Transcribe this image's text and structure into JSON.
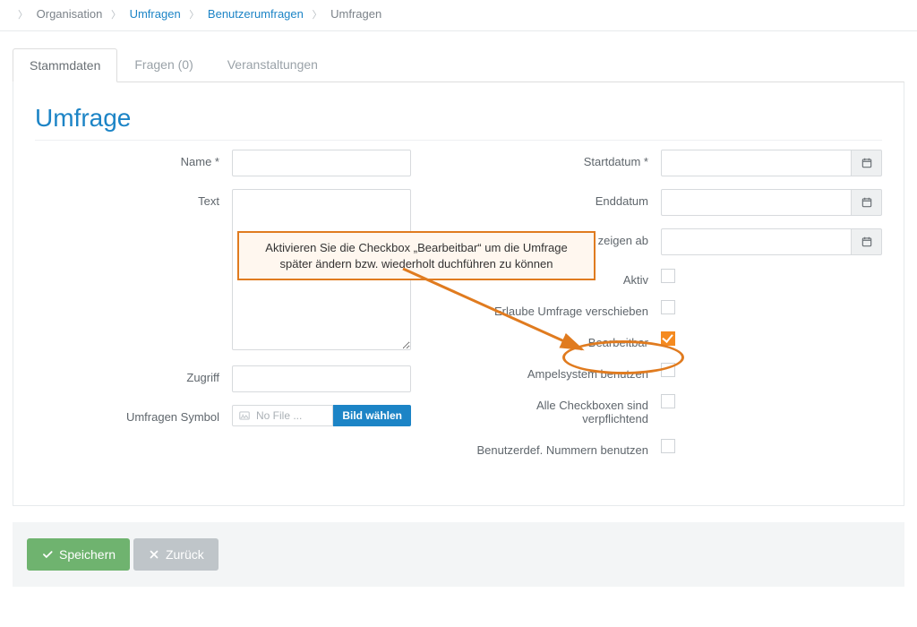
{
  "breadcrumb": {
    "root": "Organisation",
    "a": "Umfragen",
    "b": "Benutzerumfragen",
    "current": "Umfragen"
  },
  "tabs": {
    "t1": "Stammdaten",
    "t2": "Fragen (0)",
    "t3": "Veranstaltungen"
  },
  "title": "Umfrage",
  "left": {
    "name_label": "Name *",
    "text_label": "Text",
    "zugriff_label": "Zugriff",
    "symbol_label": "Umfragen Symbol",
    "nofile": "No File ...",
    "choose": "Bild wählen"
  },
  "right": {
    "start_label": "Startdatum *",
    "end_label": "Enddatum",
    "showfrom_label": "zeigen ab",
    "aktiv_label": "Aktiv",
    "move_label": "Erlaube Umfrage verschieben",
    "edit_label": "Bearbeitbar",
    "ampel_label": "Ampelsystem benutzen",
    "allreq_label": "Alle Checkboxen sind verpflichtend",
    "usernum_label": "Benutzerdef. Nummern benutzen"
  },
  "footer": {
    "save": "Speichern",
    "back": "Zurück"
  },
  "annotation": "Aktivieren Sie die Checkbox „Bearbeitbar“ um die Umfrage später ändern bzw. wiederholt duchführen zu können"
}
